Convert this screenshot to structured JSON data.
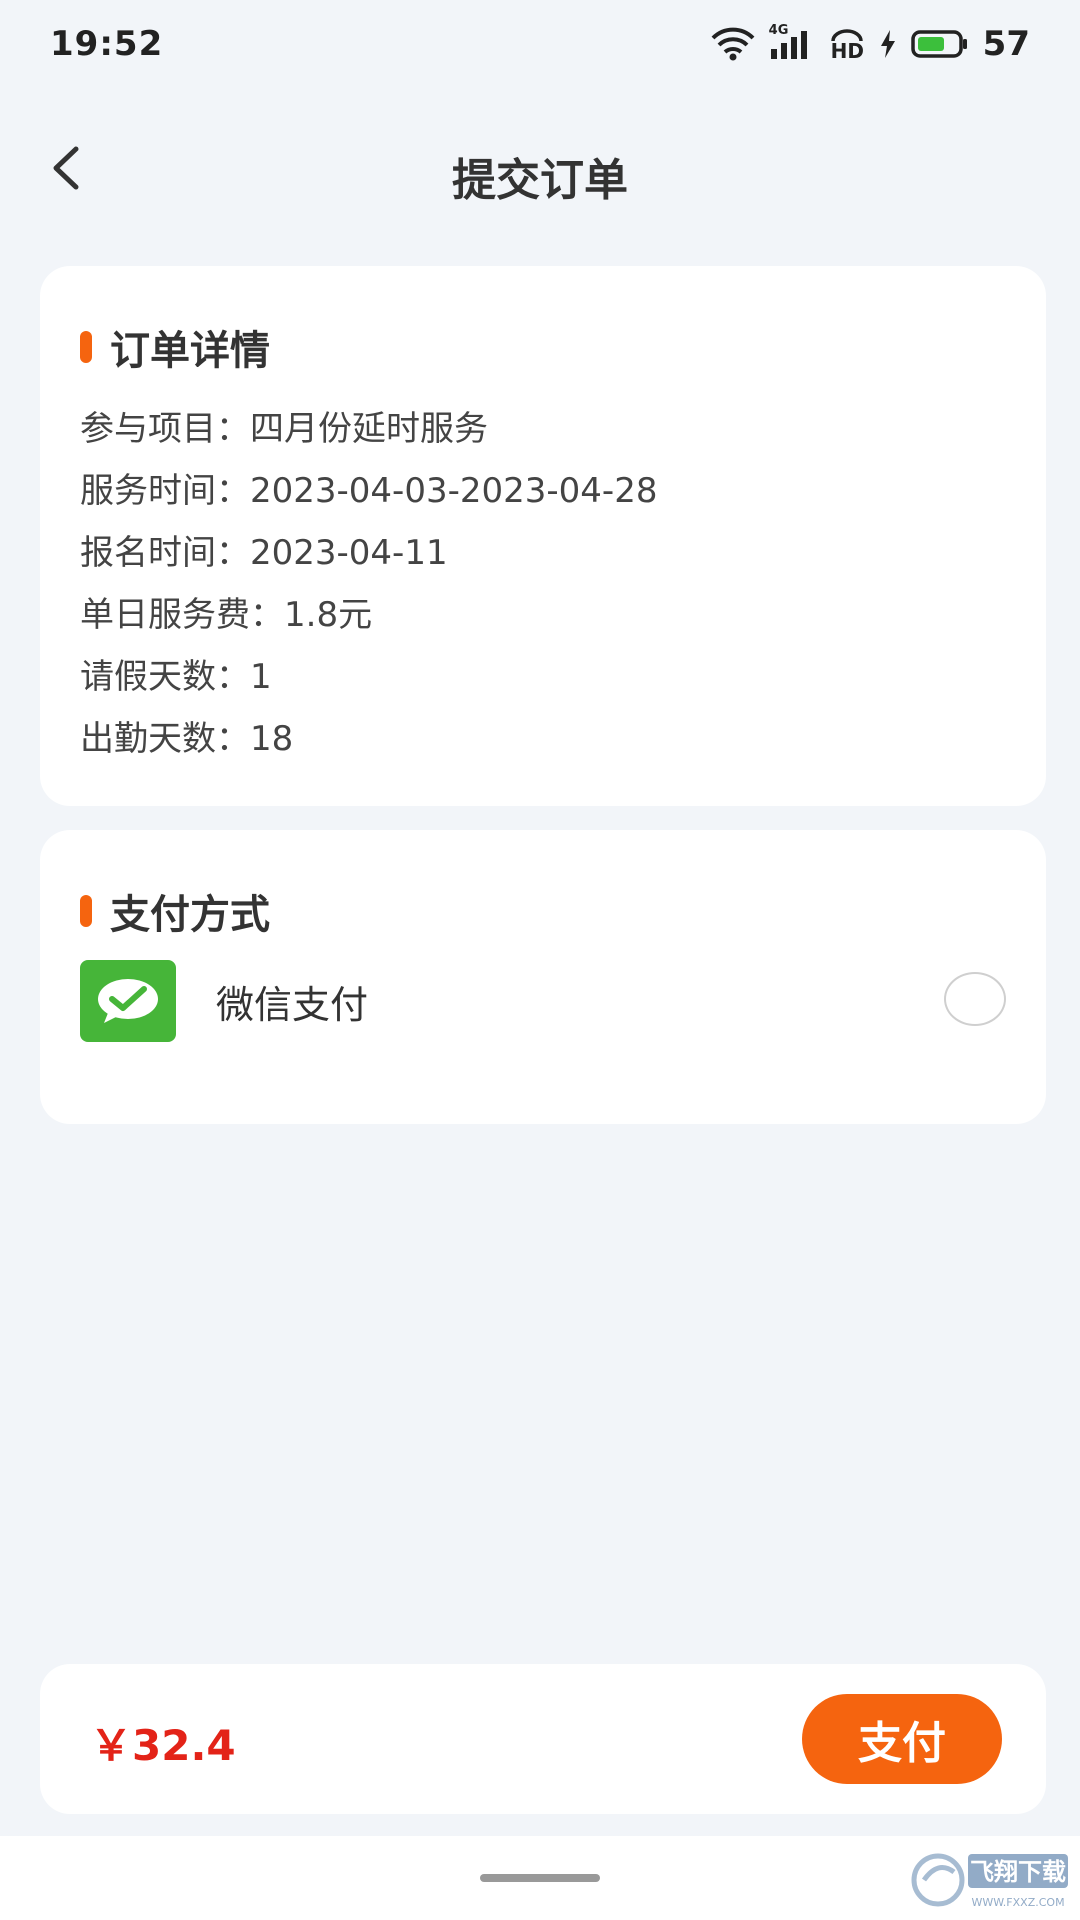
{
  "status_bar": {
    "time": "19:52",
    "network": "4G",
    "hd": "HD",
    "battery": "57",
    "icons": [
      "wifi-icon",
      "signal-icon",
      "hd-icon",
      "charging-icon",
      "battery-icon"
    ]
  },
  "nav": {
    "title": "提交订单",
    "back_icon": "chevron-left-icon"
  },
  "order": {
    "title": "订单详情",
    "rows": [
      "参与项目：四月份延时服务",
      "服务时间：2023-04-03-2023-04-28",
      "报名时间：2023-04-11",
      "单日服务费：1.8元",
      "请假天数：1",
      "出勤天数：18"
    ]
  },
  "payment": {
    "title": "支付方式",
    "option_label": "微信支付",
    "option_icon": "wechat-pay-icon",
    "selected": false
  },
  "footer": {
    "total": "￥32.4",
    "pay_label": "支付"
  },
  "watermark": {
    "text": "飞翔下载",
    "url": "WWW.FXXZ.COM"
  },
  "colors": {
    "accent": "#f5640f",
    "price": "#e32318",
    "wechat_green": "#46b539",
    "background": "#f2f5f9"
  }
}
